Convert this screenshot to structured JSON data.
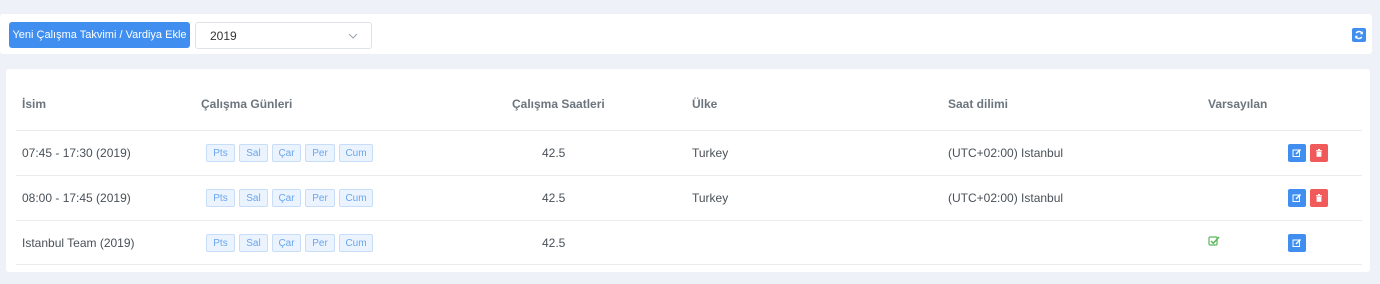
{
  "toolbar": {
    "add_button_label": "Yeni Çalışma Takvimi / Vardiya Ekle",
    "year_select_value": "2019",
    "refresh_icon": "refresh-icon"
  },
  "table": {
    "headers": {
      "name": "İsim",
      "work_days": "Çalışma Günleri",
      "work_hours": "Çalışma Saatleri",
      "country": "Ülke",
      "timezone": "Saat dilimi",
      "default": "Varsayılan"
    },
    "rows": [
      {
        "name": "07:45 - 17:30 (2019)",
        "days": [
          "Pts",
          "Sal",
          "Çar",
          "Per",
          "Cum"
        ],
        "hours": "42.5",
        "country": "Turkey",
        "timezone": "(UTC+02:00) Istanbul",
        "is_default": false
      },
      {
        "name": "08:00 - 17:45 (2019)",
        "days": [
          "Pts",
          "Sal",
          "Çar",
          "Per",
          "Cum"
        ],
        "hours": "42.5",
        "country": "Turkey",
        "timezone": "(UTC+02:00) Istanbul",
        "is_default": false
      },
      {
        "name": "Istanbul Team (2019)",
        "days": [
          "Pts",
          "Sal",
          "Çar",
          "Per",
          "Cum"
        ],
        "hours": "42.5",
        "country": "",
        "timezone": "",
        "is_default": true
      }
    ]
  },
  "colors": {
    "primary": "#3f8ef0",
    "danger": "#f05a5a",
    "success": "#5cb85c",
    "background": "#eef2f8"
  }
}
